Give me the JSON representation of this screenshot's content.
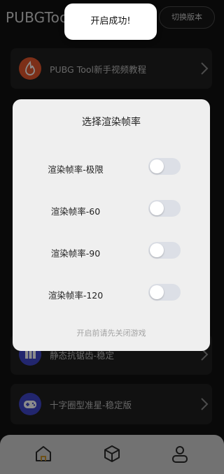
{
  "header": {
    "app_title": "PUBGTool",
    "switch_version_label": "切换版本"
  },
  "cards": [
    {
      "label": "PUBG Tool新手视频教程",
      "icon": "fire-icon"
    },
    {
      "label": "静态抗锯齿-稳定",
      "icon": "chart-icon"
    },
    {
      "label": "十字圈型准星-稳定版",
      "icon": "gamepad-icon"
    }
  ],
  "dialog": {
    "title": "选择渲染帧率",
    "options": [
      {
        "label": "渲染帧率-极限",
        "enabled": false
      },
      {
        "label": "渲染帧率-60",
        "enabled": false
      },
      {
        "label": "渲染帧率-90",
        "enabled": false
      },
      {
        "label": "渲染帧率-120",
        "enabled": false
      }
    ],
    "footer": "开启前请先关闭游戏"
  },
  "toast": {
    "message": "开启成功!"
  },
  "bottom_nav": [
    {
      "icon": "home-icon"
    },
    {
      "icon": "cube-icon"
    },
    {
      "icon": "user-icon"
    }
  ],
  "colors": {
    "background": "#121212",
    "card": "#1f1f1f",
    "dialog": "#efefef",
    "toggle_off": "#dcdfe6",
    "accent_orange": "#e2562c",
    "accent_blue": "#3f46c8"
  }
}
